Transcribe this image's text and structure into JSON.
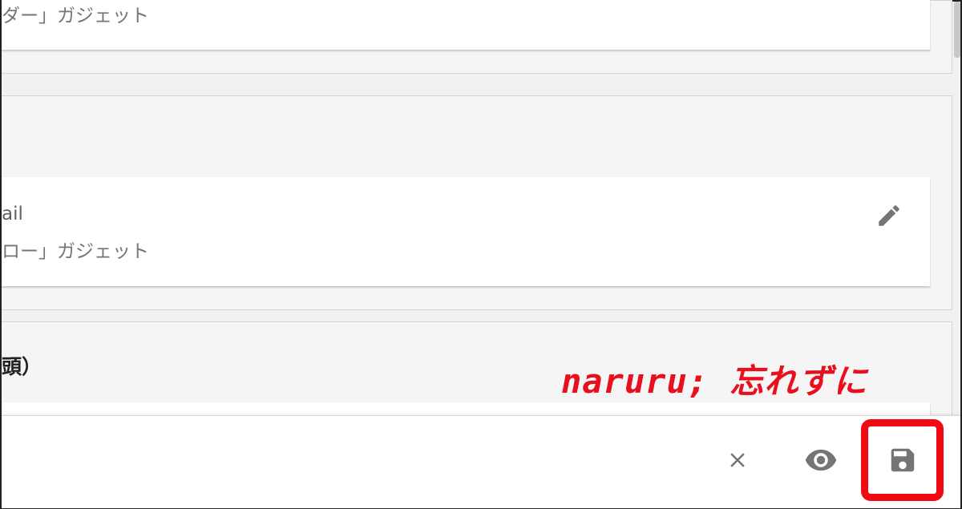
{
  "cards": {
    "top_subtitle": "ダー」ガジェット",
    "email_title": "ail",
    "email_subtitle": "ロー」ガジェット"
  },
  "section_title": "頭）",
  "annotation": "naruru; 忘れずに",
  "footer": {
    "close_icon": "close-icon",
    "preview_icon": "eye-icon",
    "save_icon": "floppy-disk-icon"
  },
  "colors": {
    "annotation": "#e8101e",
    "highlight": "#f00a14",
    "icon": "#757575"
  }
}
